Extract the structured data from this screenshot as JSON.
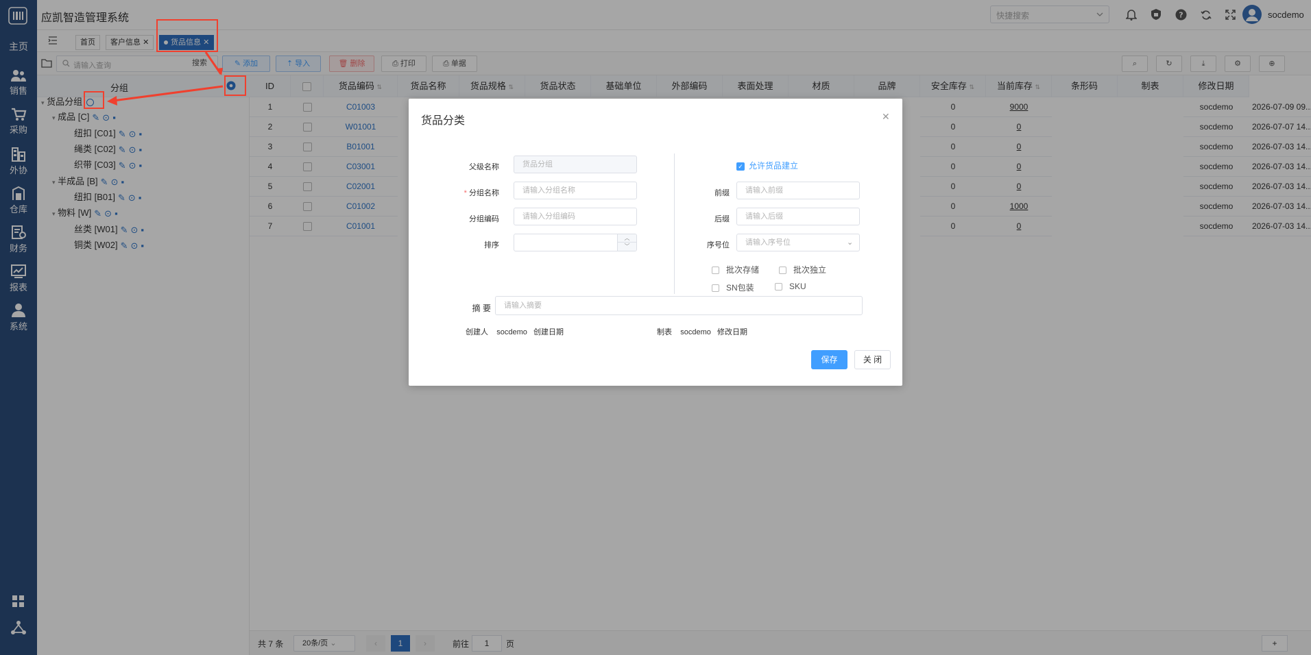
{
  "app": {
    "title": "应凯智造管理系统"
  },
  "sidebar": {
    "home": "主页",
    "items": [
      {
        "label": "销售",
        "icon": "users-icon"
      },
      {
        "label": "采购",
        "icon": "cart-icon"
      },
      {
        "label": "外协",
        "icon": "building-icon"
      },
      {
        "label": "仓库",
        "icon": "warehouse-icon"
      },
      {
        "label": "财务",
        "icon": "finance-icon"
      },
      {
        "label": "报表",
        "icon": "chart-icon"
      },
      {
        "label": "系统",
        "icon": "user-icon"
      }
    ]
  },
  "header": {
    "search_placeholder": "快捷搜索",
    "username": "socdemo"
  },
  "tabs": [
    {
      "label": "首页"
    },
    {
      "label": "客户信息"
    },
    {
      "label": "货品信息",
      "active": true
    }
  ],
  "toolbar": {
    "search_placeholder": "请输入查询",
    "search_label": "搜索",
    "add": "添加",
    "import": "导入",
    "delete": "删除",
    "print": "打印",
    "doc": "单据"
  },
  "tree": {
    "header": "分组",
    "root": "货品分组",
    "nodes": [
      {
        "label": "成品 [C]",
        "level": 1
      },
      {
        "label": "纽扣 [C01]",
        "level": 2
      },
      {
        "label": "绳类 [C02]",
        "level": 2
      },
      {
        "label": "织带 [C03]",
        "level": 2
      },
      {
        "label": "半成品 [B]",
        "level": 1
      },
      {
        "label": "纽扣 [B01]",
        "level": 2
      },
      {
        "label": "物料 [W]",
        "level": 1
      },
      {
        "label": "丝类 [W01]",
        "level": 2
      },
      {
        "label": "铜类 [W02]",
        "level": 2
      }
    ]
  },
  "table": {
    "columns": [
      "ID",
      "",
      "货品编码",
      "货品名称",
      "货品规格",
      "货品状态",
      "基础单位",
      "外部编码",
      "表面处理",
      "材质",
      "品牌",
      "安全库存",
      "当前库存",
      "条形码",
      "制表",
      "修改日期"
    ],
    "rows": [
      {
        "id": "1",
        "code": "C01003",
        "safe": "0",
        "stock": "9000",
        "maker": "socdemo",
        "date": "2026-07-09 09..."
      },
      {
        "id": "2",
        "code": "W01001",
        "safe": "0",
        "stock": "0",
        "maker": "socdemo",
        "date": "2026-07-07 14..."
      },
      {
        "id": "3",
        "code": "B01001",
        "safe": "0",
        "stock": "0",
        "maker": "socdemo",
        "date": "2026-07-03 14..."
      },
      {
        "id": "4",
        "code": "C03001",
        "safe": "0",
        "stock": "0",
        "maker": "socdemo",
        "date": "2026-07-03 14..."
      },
      {
        "id": "5",
        "code": "C02001",
        "safe": "0",
        "stock": "0",
        "maker": "socdemo",
        "date": "2026-07-03 14..."
      },
      {
        "id": "6",
        "code": "C01002",
        "safe": "0",
        "stock": "1000",
        "maker": "socdemo",
        "date": "2026-07-03 14..."
      },
      {
        "id": "7",
        "code": "C01001",
        "safe": "0",
        "stock": "0",
        "maker": "socdemo",
        "date": "2026-07-03 14..."
      }
    ]
  },
  "pager": {
    "total": "共 7 条",
    "page_size": "20条/页",
    "current": "1",
    "goto_prefix": "前往",
    "goto_value": "1",
    "goto_suffix": "页"
  },
  "modal": {
    "title": "货品分类",
    "parent_label": "父级名称",
    "parent_value": "货品分组",
    "name_label": "分组名称",
    "name_placeholder": "请输入分组名称",
    "code_label": "分组编码",
    "code_placeholder": "请输入分组编码",
    "sort_label": "排序",
    "allow_label": "允许货品建立",
    "prefix_label": "前缀",
    "prefix_placeholder": "请输入前缀",
    "suffix_label": "后缀",
    "suffix_placeholder": "请输入后缀",
    "serial_label": "序号位",
    "serial_placeholder": "请输入序号位",
    "cb_batch_store": "批次存储",
    "cb_batch_independent": "批次独立",
    "cb_sn": "SN包装",
    "cb_sku": "SKU",
    "summary_label": "摘 要",
    "summary_placeholder": "请输入摘要",
    "creator_label": "创建人",
    "creator_value": "socdemo",
    "create_date_label": "创建日期",
    "maker_label": "制表",
    "maker_value": "socdemo",
    "modify_date_label": "修改日期",
    "save": "保存",
    "close": "关 闭"
  },
  "colors": {
    "sidebar": "#2c4d7c",
    "primary": "#409eff",
    "annotation": "#f0402e",
    "link": "#2f76c9"
  }
}
